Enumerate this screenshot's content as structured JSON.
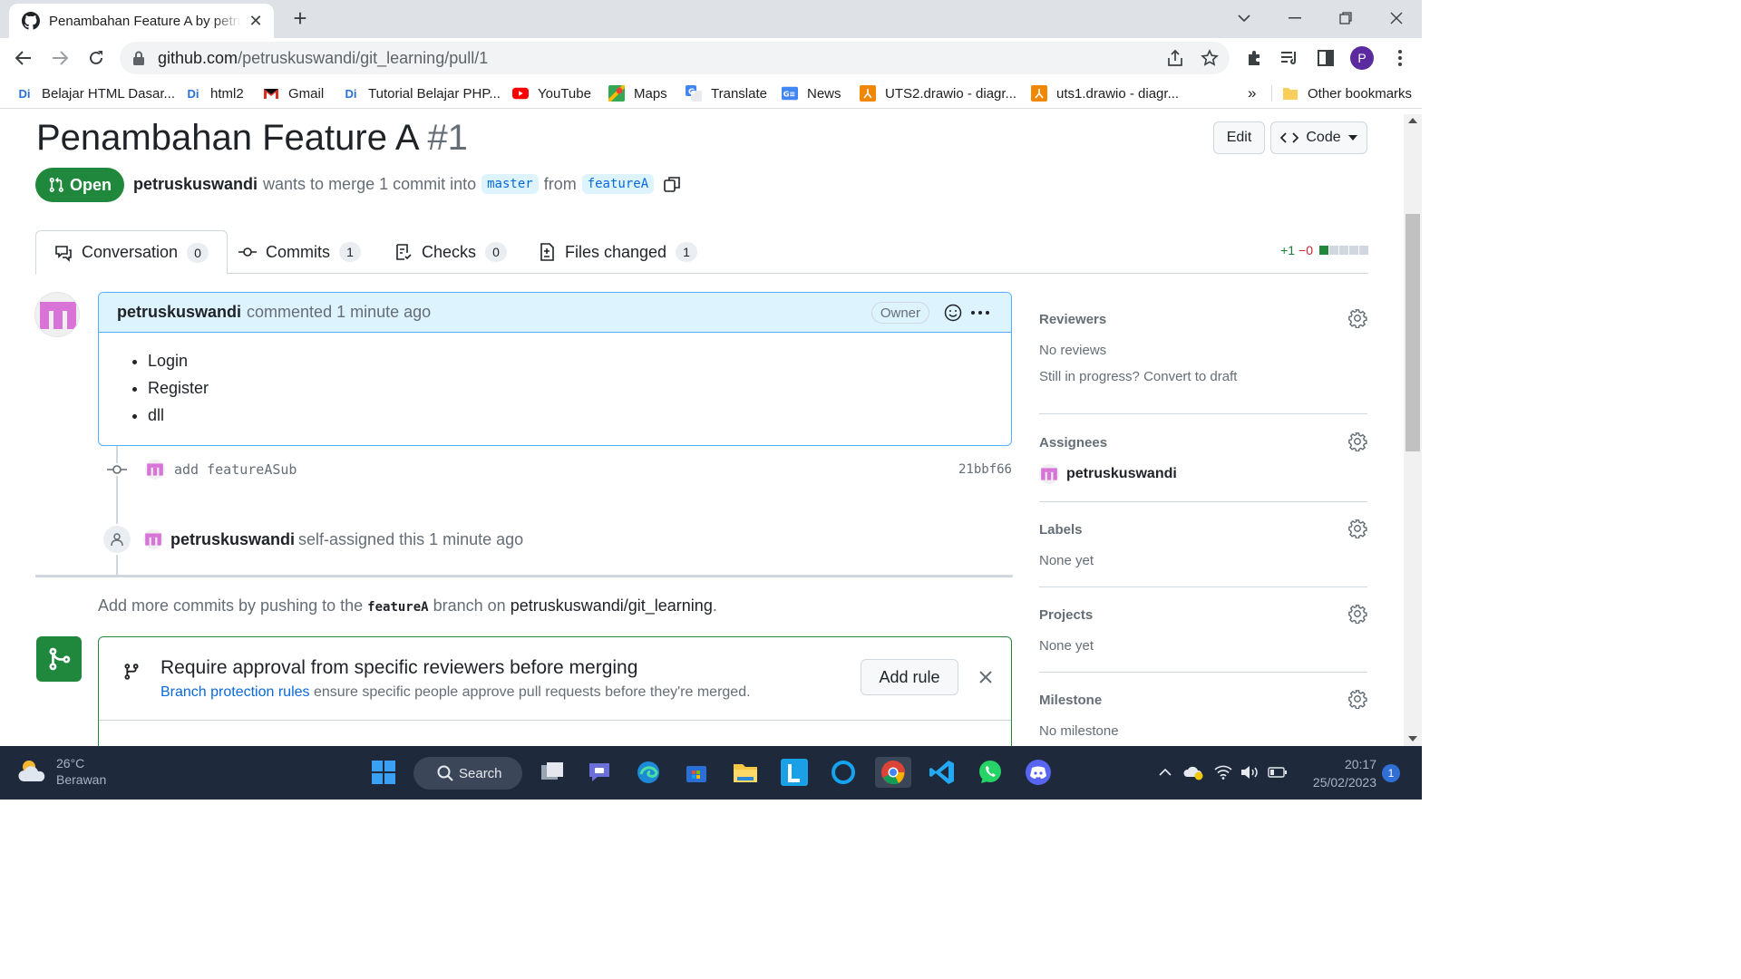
{
  "browser": {
    "tab_title": "Penambahan Feature A by petruskuswandi",
    "url_host": "github.com",
    "url_path": "/petruskuswandi/git_learning/pull/1",
    "profile_initial": "P"
  },
  "bookmarks": [
    {
      "label": "Belajar HTML Dasar...",
      "icon": "Di"
    },
    {
      "label": "html2",
      "icon": "Di"
    },
    {
      "label": "Gmail",
      "icon": "gmail-icon"
    },
    {
      "label": "Tutorial Belajar PHP...",
      "icon": "Di"
    },
    {
      "label": "YouTube",
      "icon": "youtube-icon"
    },
    {
      "label": "Maps",
      "icon": "maps-icon"
    },
    {
      "label": "Translate",
      "icon": "translate-icon"
    },
    {
      "label": "News",
      "icon": "news-icon"
    },
    {
      "label": "UTS2.drawio - diagr...",
      "icon": "drawio-icon"
    },
    {
      "label": "uts1.drawio - diagr...",
      "icon": "drawio-icon"
    }
  ],
  "bookmarks_overflow": "»",
  "other_bookmarks": "Other bookmarks",
  "pr": {
    "title": "Penambahan Feature A",
    "number": "#1",
    "edit_label": "Edit",
    "code_label": "Code",
    "state": "Open",
    "author": "petruskuswandi",
    "merge_text": "wants to merge 1 commit into",
    "base_branch": "master",
    "from_text": "from",
    "head_branch": "featureA"
  },
  "tabs": [
    {
      "label": "Conversation",
      "count": "0"
    },
    {
      "label": "Commits",
      "count": "1"
    },
    {
      "label": "Checks",
      "count": "0"
    },
    {
      "label": "Files changed",
      "count": "1"
    }
  ],
  "diffstat": {
    "added": "+1",
    "deleted": "−0"
  },
  "comment": {
    "author": "petruskuswandi",
    "meta": "commented 1 minute ago",
    "role": "Owner",
    "items": [
      "Login",
      "Register",
      "dll"
    ]
  },
  "commit": {
    "message": "add featureASub",
    "sha": "21bbf66"
  },
  "event": {
    "author": "petruskuswandi",
    "text": "self-assigned this 1 minute ago"
  },
  "hint": {
    "prefix": "Add more commits by pushing to the",
    "branch": "featureA",
    "middle": "branch on",
    "repo": "petruskuswandi/git_learning",
    "suffix": "."
  },
  "merge_box": {
    "title": "Require approval from specific reviewers before merging",
    "link": "Branch protection rules",
    "desc": "ensure specific people approve pull requests before they're merged.",
    "button": "Add rule"
  },
  "sidebar": {
    "reviewers": {
      "title": "Reviewers",
      "value": "No reviews",
      "progress": "Still in progress?",
      "draft_link": "Convert to draft"
    },
    "assignees": {
      "title": "Assignees",
      "value": "petruskuswandi"
    },
    "labels": {
      "title": "Labels",
      "value": "None yet"
    },
    "projects": {
      "title": "Projects",
      "value": "None yet"
    },
    "milestone": {
      "title": "Milestone",
      "value": "No milestone"
    }
  },
  "taskbar": {
    "temperature": "26°C",
    "weather": "Berawan",
    "search_label": "Search",
    "time": "20:17",
    "date": "25/02/2023",
    "notifications": "1"
  },
  "colors": {
    "accent_green": "#1f883d",
    "link_blue": "#0969da",
    "comment_header": "#ddf4ff"
  }
}
